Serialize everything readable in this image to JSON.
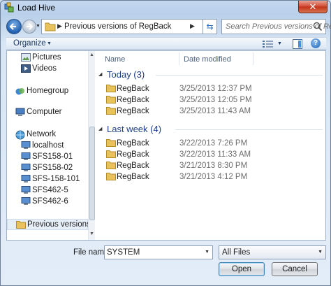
{
  "window": {
    "title": "Load Hive",
    "close_glyph": "✕"
  },
  "address": {
    "path": "Previous versions of RegBack",
    "search_placeholder": "Search Previous versions of Re..."
  },
  "toolbar": {
    "organize": "Organize"
  },
  "navigation": {
    "items": [
      {
        "label": "Pictures",
        "icon": "pictures-icon",
        "indent": 1
      },
      {
        "label": "Videos",
        "icon": "videos-icon",
        "indent": 1
      },
      {
        "label": "Homegroup",
        "icon": "homegroup-icon",
        "indent": 0
      },
      {
        "label": "Computer",
        "icon": "computer-icon",
        "indent": 0
      },
      {
        "label": "Network",
        "icon": "network-icon",
        "indent": 0
      },
      {
        "label": "localhost",
        "icon": "pc-icon",
        "indent": 1
      },
      {
        "label": "SFS158-01",
        "icon": "pc-icon",
        "indent": 1
      },
      {
        "label": "SFS158-02",
        "icon": "pc-icon",
        "indent": 1
      },
      {
        "label": "SFS-158-101",
        "icon": "pc-icon",
        "indent": 1
      },
      {
        "label": "SFS462-5",
        "icon": "pc-icon",
        "indent": 1
      },
      {
        "label": "SFS462-6",
        "icon": "pc-icon",
        "indent": 1
      },
      {
        "label": "Previous versions c",
        "icon": "folder-icon",
        "indent": 0,
        "selected": true
      }
    ]
  },
  "columns": {
    "name": "Name",
    "date": "Date modified"
  },
  "groups": [
    {
      "label": "Today (3)",
      "files": [
        {
          "name": "RegBack",
          "date": "3/25/2013 12:37 PM"
        },
        {
          "name": "RegBack",
          "date": "3/25/2013 12:05 PM"
        },
        {
          "name": "RegBack",
          "date": "3/25/2013 11:43 AM"
        }
      ]
    },
    {
      "label": "Last week (4)",
      "files": [
        {
          "name": "RegBack",
          "date": "3/22/2013 7:26 PM"
        },
        {
          "name": "RegBack",
          "date": "3/22/2013 11:33 AM"
        },
        {
          "name": "RegBack",
          "date": "3/21/2013 8:30 PM"
        },
        {
          "name": "RegBack",
          "date": "3/21/2013 4:12 PM"
        }
      ]
    }
  ],
  "footer": {
    "filename_label": "File name:",
    "filename_value": "SYSTEM",
    "filter_value": "All Files",
    "open_label": "Open",
    "cancel_label": "Cancel"
  },
  "colors": {
    "folder": "#e8c35c",
    "group_header": "#1e3f86"
  }
}
